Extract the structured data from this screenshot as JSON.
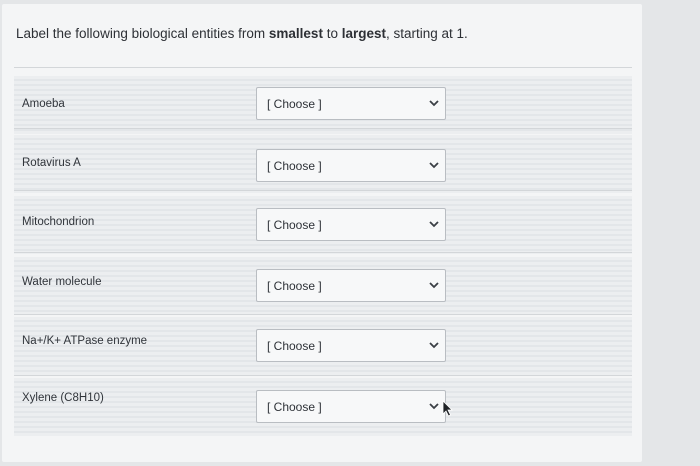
{
  "question": {
    "prefix": "Label the following biological entities from ",
    "smallest": "smallest",
    "middle": " to ",
    "largest": "largest",
    "suffix": ", starting at 1."
  },
  "rows": [
    {
      "label": "Amoeba",
      "selected": "[ Choose ]"
    },
    {
      "label": "Rotavirus A",
      "selected": "[ Choose ]"
    },
    {
      "label": "Mitochondrion",
      "selected": "[ Choose ]"
    },
    {
      "label": "Water molecule",
      "selected": "[ Choose ]"
    },
    {
      "label": "Na+/K+ ATPase enzyme",
      "selected": "[ Choose ]"
    },
    {
      "label": "Xylene (C8H10)",
      "selected": "[ Choose ]"
    }
  ],
  "icons": {
    "dropdown": "chevron-down-icon",
    "pointer": "mouse-pointer-icon"
  }
}
